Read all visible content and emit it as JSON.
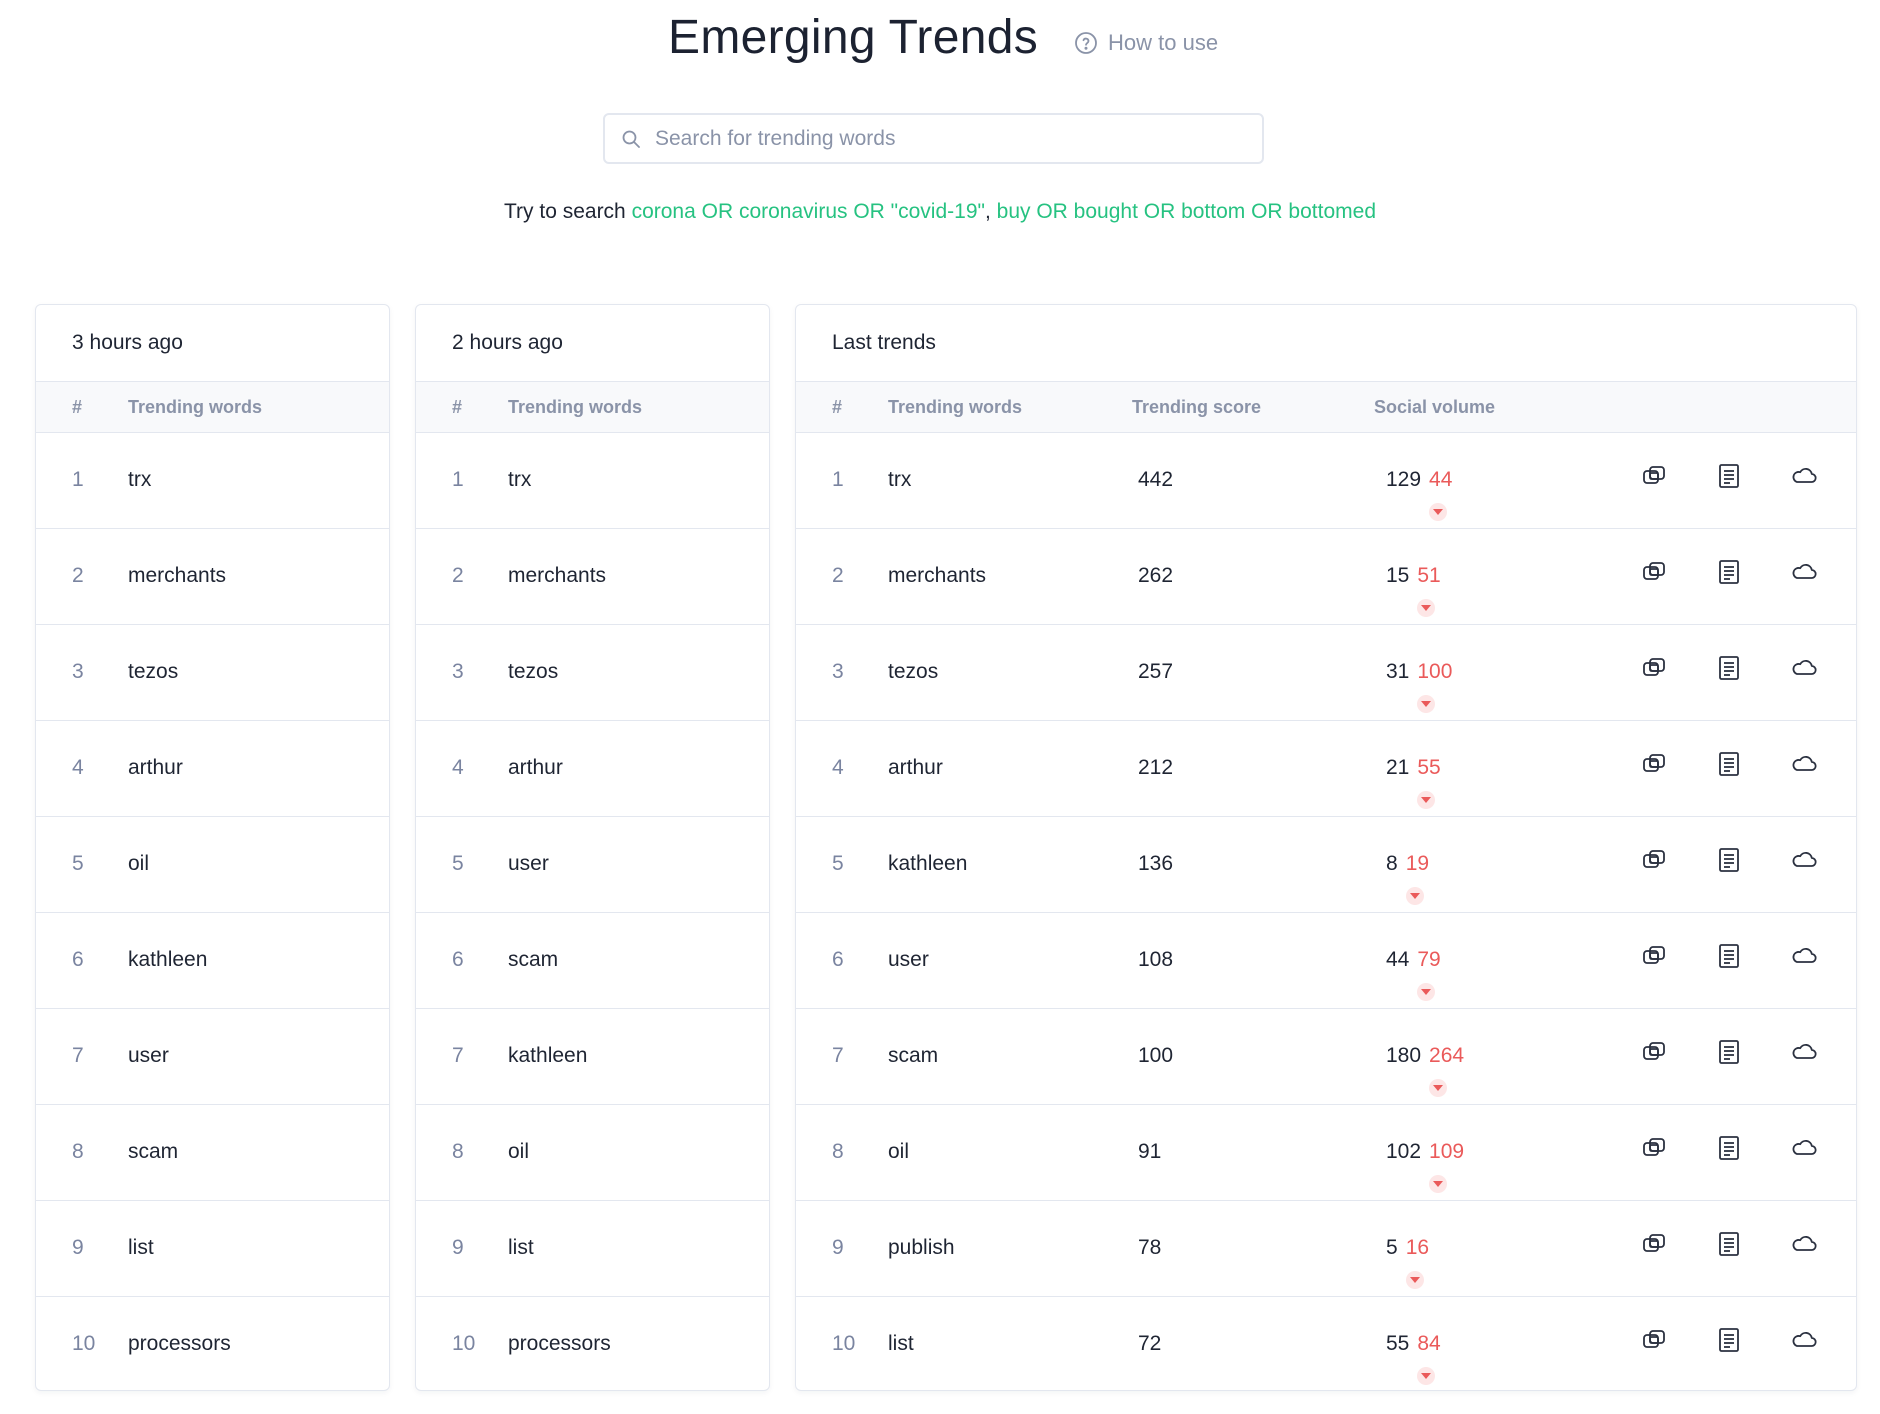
{
  "header": {
    "title": "Emerging Trends",
    "how_to_use": "How to use"
  },
  "search": {
    "placeholder": "Search for trending words",
    "value": ""
  },
  "suggestions": {
    "prefix": "Try to search ",
    "query1": "corona OR coronavirus OR \"covid-19\"",
    "separator": ", ",
    "query2": "buy OR bought OR bottom OR bottomed"
  },
  "colors": {
    "accent_green": "#26c281",
    "negative_red": "#ea5a5a",
    "muted_text": "#8a93a8"
  },
  "panels": [
    {
      "title": "3 hours ago",
      "columns": [
        "#",
        "Trending words"
      ],
      "rows": [
        {
          "num": "1",
          "word": "trx"
        },
        {
          "num": "2",
          "word": "merchants"
        },
        {
          "num": "3",
          "word": "tezos"
        },
        {
          "num": "4",
          "word": "arthur"
        },
        {
          "num": "5",
          "word": "oil"
        },
        {
          "num": "6",
          "word": "kathleen"
        },
        {
          "num": "7",
          "word": "user"
        },
        {
          "num": "8",
          "word": "scam"
        },
        {
          "num": "9",
          "word": "list"
        },
        {
          "num": "10",
          "word": "processors"
        }
      ]
    },
    {
      "title": "2 hours ago",
      "columns": [
        "#",
        "Trending words"
      ],
      "rows": [
        {
          "num": "1",
          "word": "trx"
        },
        {
          "num": "2",
          "word": "merchants"
        },
        {
          "num": "3",
          "word": "tezos"
        },
        {
          "num": "4",
          "word": "arthur"
        },
        {
          "num": "5",
          "word": "user"
        },
        {
          "num": "6",
          "word": "scam"
        },
        {
          "num": "7",
          "word": "kathleen"
        },
        {
          "num": "8",
          "word": "oil"
        },
        {
          "num": "9",
          "word": "list"
        },
        {
          "num": "10",
          "word": "processors"
        }
      ]
    },
    {
      "title": "Last trends",
      "columns": [
        "#",
        "Trending words",
        "Trending score",
        "Social volume"
      ],
      "action_icons": [
        "compare-icon",
        "news-icon",
        "word-cloud-icon"
      ],
      "rows": [
        {
          "num": "1",
          "word": "trx",
          "score": "442",
          "volume": "129",
          "change": "44"
        },
        {
          "num": "2",
          "word": "merchants",
          "score": "262",
          "volume": "15",
          "change": "51"
        },
        {
          "num": "3",
          "word": "tezos",
          "score": "257",
          "volume": "31",
          "change": "100"
        },
        {
          "num": "4",
          "word": "arthur",
          "score": "212",
          "volume": "21",
          "change": "55"
        },
        {
          "num": "5",
          "word": "kathleen",
          "score": "136",
          "volume": "8",
          "change": "19"
        },
        {
          "num": "6",
          "word": "user",
          "score": "108",
          "volume": "44",
          "change": "79"
        },
        {
          "num": "7",
          "word": "scam",
          "score": "100",
          "volume": "180",
          "change": "264"
        },
        {
          "num": "8",
          "word": "oil",
          "score": "91",
          "volume": "102",
          "change": "109"
        },
        {
          "num": "9",
          "word": "publish",
          "score": "78",
          "volume": "5",
          "change": "16"
        },
        {
          "num": "10",
          "word": "list",
          "score": "72",
          "volume": "55",
          "change": "84"
        }
      ]
    }
  ]
}
